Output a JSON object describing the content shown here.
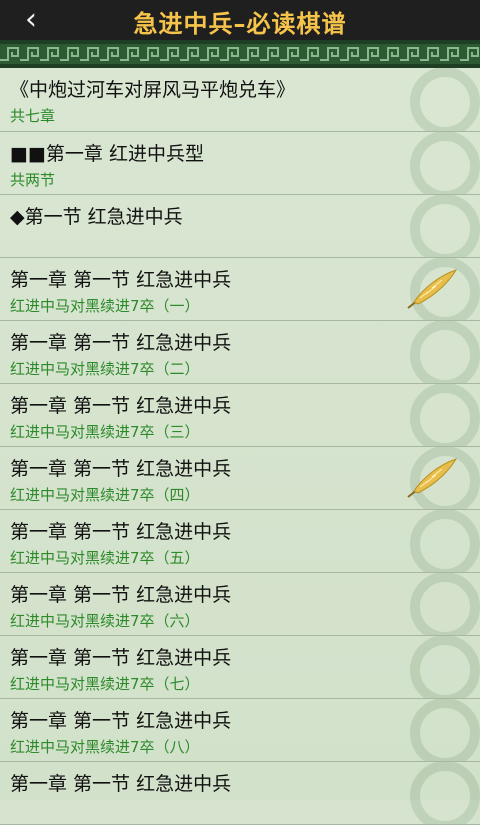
{
  "header": {
    "title": "急进中兵–必读棋谱",
    "back_icon": "chevron-left-icon"
  },
  "list": {
    "items": [
      {
        "title": "《中炮过河车对屏风马平炮兑车》",
        "subtitle": "共七章",
        "marker": ""
      },
      {
        "title": "■■第一章 红进中兵型",
        "subtitle": "共两节",
        "marker": ""
      },
      {
        "title": "◆第一节 红急进中兵",
        "subtitle": "",
        "marker": ""
      },
      {
        "title": "第一章 第一节 红急进中兵",
        "subtitle": "红进中马对黑续进7卒（一）",
        "marker": "quill-icon"
      },
      {
        "title": "第一章 第一节 红急进中兵",
        "subtitle": "红进中马对黑续进7卒（二）",
        "marker": ""
      },
      {
        "title": "第一章 第一节 红急进中兵",
        "subtitle": "红进中马对黑续进7卒（三）",
        "marker": ""
      },
      {
        "title": "第一章 第一节 红急进中兵",
        "subtitle": "红进中马对黑续进7卒（四）",
        "marker": "quill-icon"
      },
      {
        "title": "第一章 第一节 红急进中兵",
        "subtitle": "红进中马对黑续进7卒（五）",
        "marker": ""
      },
      {
        "title": "第一章 第一节 红急进中兵",
        "subtitle": "红进中马对黑续进7卒（六）",
        "marker": ""
      },
      {
        "title": "第一章 第一节 红急进中兵",
        "subtitle": "红进中马对黑续进7卒（七）",
        "marker": ""
      },
      {
        "title": "第一章 第一节 红急进中兵",
        "subtitle": "红进中马对黑续进7卒（八）",
        "marker": ""
      },
      {
        "title": "第一章 第一节 红急进中兵",
        "subtitle": "",
        "marker": ""
      }
    ]
  },
  "colors": {
    "header_bg": "#1f1f1f",
    "title": "#f6c44a",
    "border_band": "#2e5a33",
    "list_bg": "#d6e4cf",
    "title_text": "#111111",
    "subtitle_text": "#2d8a2a"
  }
}
